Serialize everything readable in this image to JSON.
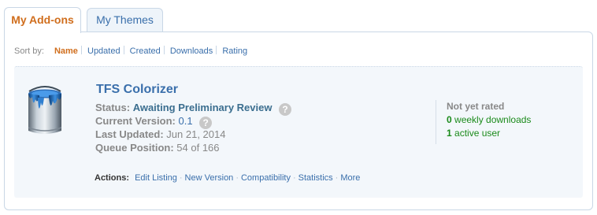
{
  "tabs": [
    {
      "label": "My Add-ons"
    },
    {
      "label": "My Themes"
    }
  ],
  "sort": {
    "label": "Sort by:",
    "options": [
      "Name",
      "Updated",
      "Created",
      "Downloads",
      "Rating"
    ],
    "selected": "Name"
  },
  "addon": {
    "icon": "paint-can-icon",
    "title": "TFS Colorizer",
    "status_label": "Status:",
    "status_value": "Awaiting Preliminary Review",
    "version_label": "Current Version:",
    "version_value": "0.1",
    "updated_label": "Last Updated:",
    "updated_value": "Jun 21, 2014",
    "queue_label": "Queue Position:",
    "queue_value": "54 of 166",
    "actions_label": "Actions:",
    "actions": [
      "Edit Listing",
      "New Version",
      "Compatibility",
      "Statistics",
      "More"
    ],
    "rating": "Not yet rated",
    "weekly_downloads_count": "0",
    "weekly_downloads_label": "weekly downloads",
    "active_users_count": "1",
    "active_users_label": "active user"
  },
  "colors": {
    "accent_orange": "#d06e1d",
    "link_blue": "#3a6fab",
    "success_green": "#1a8a1a",
    "border": "#c9d7e6"
  }
}
